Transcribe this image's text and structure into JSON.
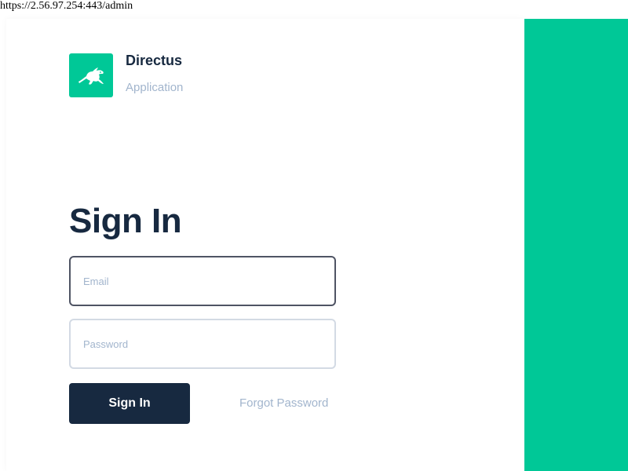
{
  "browser": {
    "url": "https://2.56.97.254:443/admin"
  },
  "brand": {
    "name": "Directus",
    "subtitle": "Application",
    "logo_icon": "rabbit-icon",
    "accent_color": "#00c897"
  },
  "login": {
    "title": "Sign In",
    "email_placeholder": "Email",
    "email_value": "",
    "password_placeholder": "Password",
    "password_value": "",
    "submit_label": "Sign In",
    "forgot_label": "Forgot Password"
  },
  "colors": {
    "primary_dark": "#172940",
    "muted_text": "#a2b5cd",
    "hero_background": "#00c897"
  }
}
